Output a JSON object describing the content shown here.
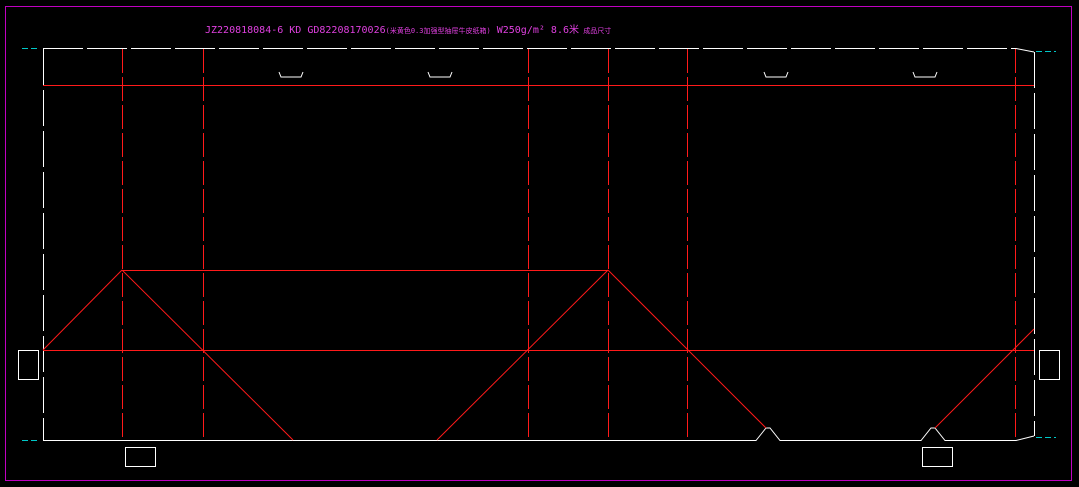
{
  "drawing": {
    "title_parts": [
      {
        "text": "JZ220818084-6  KD  GD82208170026",
        "small": false
      },
      {
        "text": "(米黄色0.3加强型抽屉牛皮纸箱)",
        "small": true
      },
      {
        "text": " W250g/m²  ",
        "small": false
      },
      {
        "text": "8.6米",
        "small": false
      },
      {
        "text": " 成品尺寸",
        "small": true
      }
    ]
  },
  "colors": {
    "background": "#000000",
    "frame": "#c000c0",
    "outline": "#ffffff",
    "fold": "#ff1a1a",
    "center_mark": "#00c8c8",
    "title": "#e040e0"
  }
}
